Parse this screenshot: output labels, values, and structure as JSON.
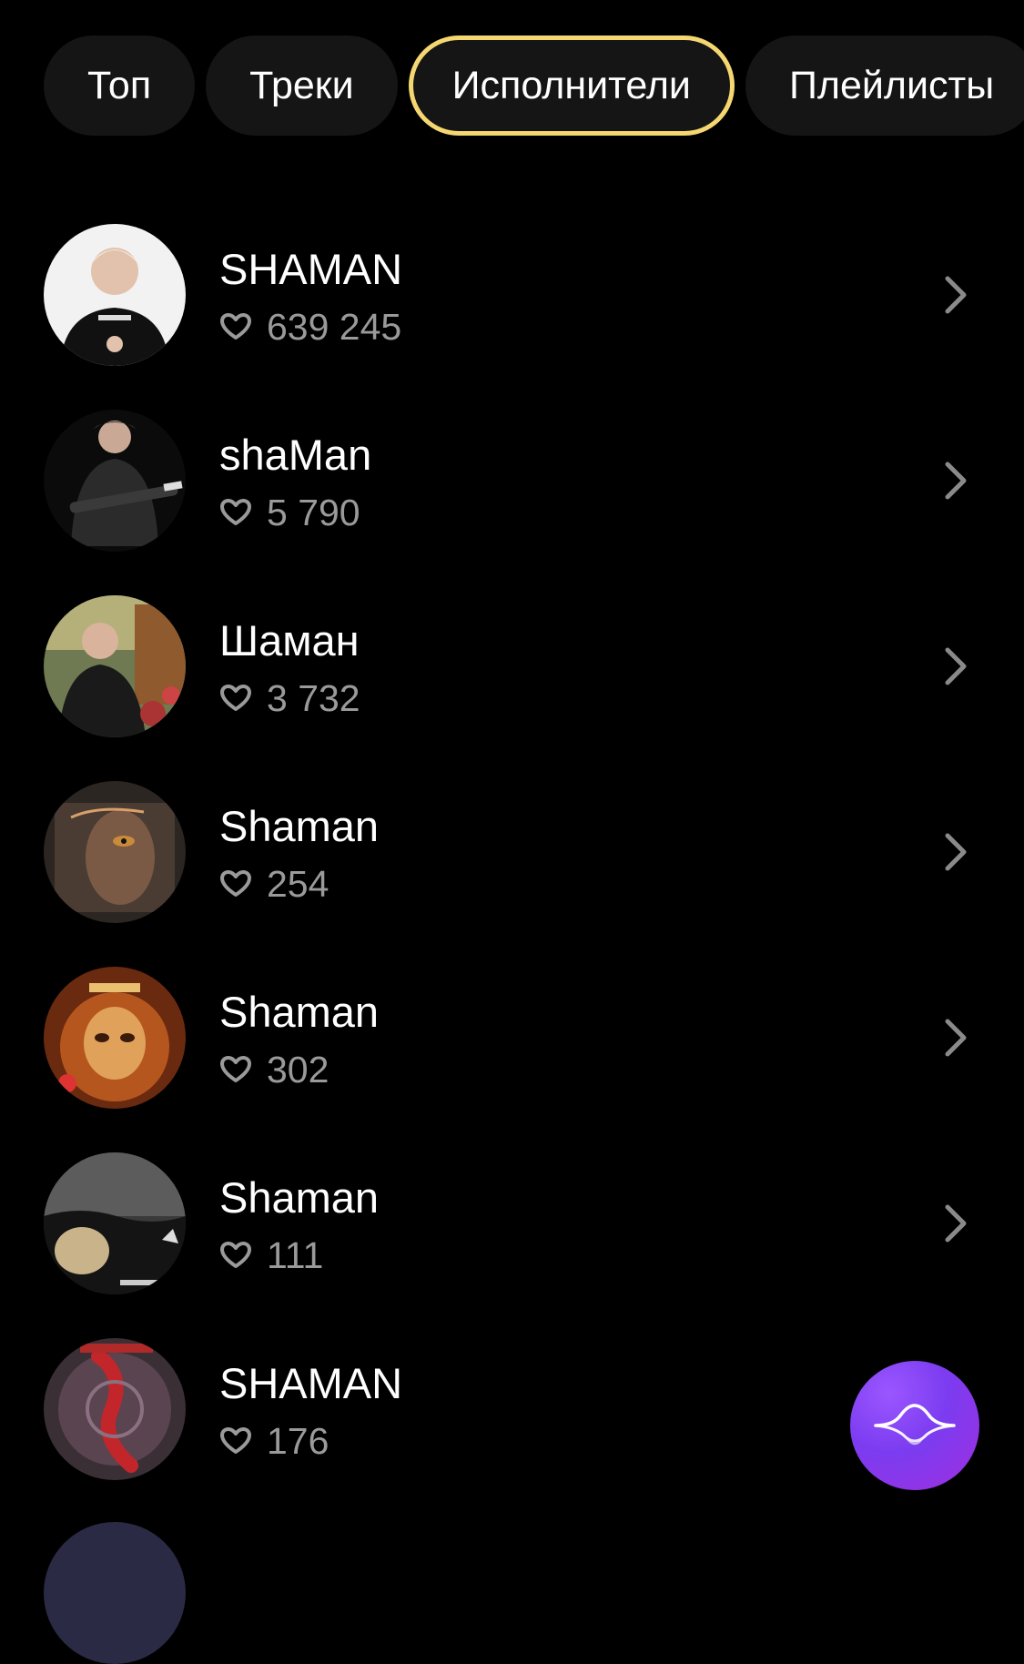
{
  "tabs": [
    {
      "label": "Топ",
      "active": false
    },
    {
      "label": "Треки",
      "active": false
    },
    {
      "label": "Исполнители",
      "active": true
    },
    {
      "label": "Плейлисты",
      "active": false
    }
  ],
  "artists": [
    {
      "name": "SHAMAN",
      "likes": "639 245"
    },
    {
      "name": "shaMan",
      "likes": "5 790"
    },
    {
      "name": "Шаман",
      "likes": "3 732"
    },
    {
      "name": "Shaman",
      "likes": "254"
    },
    {
      "name": "Shaman",
      "likes": "302"
    },
    {
      "name": "Shaman",
      "likes": "111"
    },
    {
      "name": "SHAMAN",
      "likes": "176"
    }
  ],
  "icons": {
    "like": "heart-icon",
    "open": "chevron-right-icon",
    "fab": "wave-icon"
  },
  "colors": {
    "background": "#000000",
    "tab_background": "#151515",
    "active_tab_border": "#f5d772",
    "secondary_text": "#9a9a9a",
    "fab": "#7b3cf0"
  }
}
